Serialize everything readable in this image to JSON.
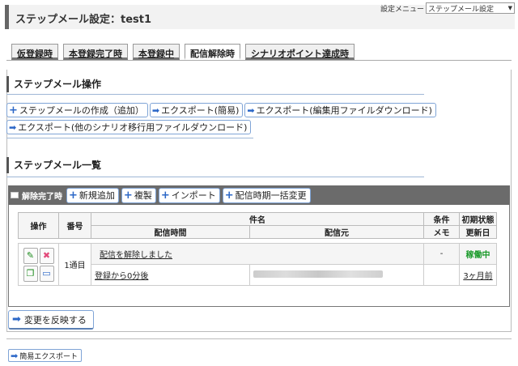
{
  "page": {
    "title": "ステップメール設定：test1"
  },
  "settings_menu": {
    "label": "設定メニュー",
    "selected": "ステップメール設定"
  },
  "tabs": [
    {
      "label": "仮登録時",
      "active": false
    },
    {
      "label": "本登録完了時",
      "active": false
    },
    {
      "label": "本登録中",
      "active": false
    },
    {
      "label": "配信解除時",
      "active": true
    },
    {
      "label": "シナリオポイント達成時",
      "active": false
    }
  ],
  "operations": {
    "title": "ステップメール操作",
    "create": "ステップメールの作成（追加）",
    "export_simple": "エクスポート(簡易)",
    "export_edit": "エクスポート(編集用ファイルダウンロード)",
    "export_other": "エクスポート(他のシナリオ移行用ファイルダウンロード)"
  },
  "list": {
    "title": "ステップメール一覧",
    "category": "解除完了時",
    "add_new": "新規追加",
    "duplicate": "複製",
    "import": "インポート",
    "bulk_change": "配信時期一括変更"
  },
  "table": {
    "headers": {
      "operation": "操作",
      "number": "番号",
      "subject": "件名",
      "condition": "条件",
      "initial_state": "初期状態",
      "delivery_time": "配信時間",
      "sender": "配信元",
      "memo": "メモ",
      "updated": "更新日"
    },
    "rows": [
      {
        "number": "1通目",
        "subject": "配信を解除しました",
        "condition": "-",
        "status": "稼働中",
        "delivery_time": "登録から0分後",
        "updated": "3ヶ月前"
      }
    ]
  },
  "apply_label": "変更を反映する",
  "easy_export_label": "簡易エクスポート",
  "colors": {
    "accent": "#2b67c7",
    "status_active": "#1a9a2a",
    "header_bg": "#6b6b6b"
  }
}
